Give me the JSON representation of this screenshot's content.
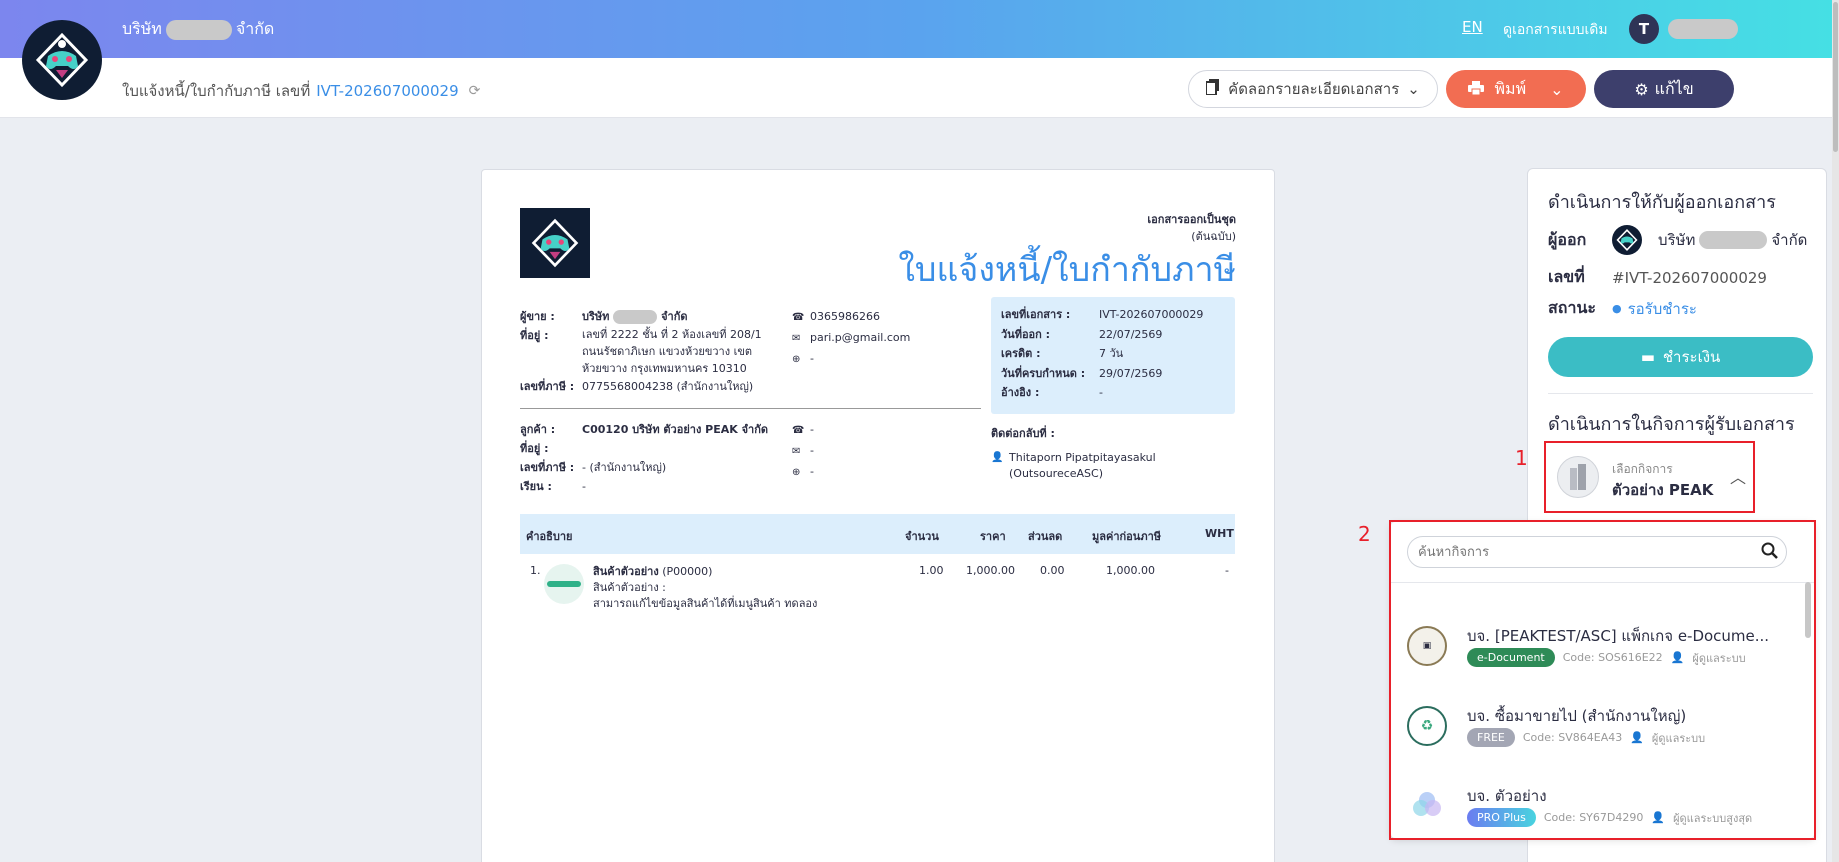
{
  "header": {
    "company_prefix": "บริษัท",
    "company_suffix": "จำกัด",
    "lang": "EN",
    "legacy_docs": "ดูเอกสารแบบเดิม",
    "user_initial": "T"
  },
  "subheader": {
    "doc_type": "ใบแจ้งหนี้/ใบกำกับภาษี เลขที่",
    "doc_number": "IVT-202607000029",
    "copy_label": "คัดลอกรายละเอียดเอกสาร",
    "print_label": "พิมพ์",
    "edit_label": "แก้ไข"
  },
  "document": {
    "series_label": "เอกสารออกเป็นชุด",
    "original_label": "(ต้นฉบับ)",
    "title": "ใบแจ้งหนี้/ใบกำกับภาษี",
    "seller": {
      "seller_label": "ผู้ขาย :",
      "seller_prefix": "บริษัท",
      "seller_suffix": "จำกัด",
      "address_label": "ที่อยู่ :",
      "address": "เลขที่ 2222 ชั้น ที่ 2 ห้องเลขที่ 208/1 ถนนรัชดาภิเษก แขวงห้วยขวาง เขตห้วยขวาง กรุงเทพมหานคร 10310",
      "tax_label": "เลขที่ภาษี :",
      "tax_id": "0775568004238 (สำนักงานใหญ่)",
      "phone": "0365986266",
      "email": "pari.p@gmail.com",
      "web": "-"
    },
    "customer": {
      "customer_label": "ลูกค้า :",
      "customer": "C00120 บริษัท ตัวอย่าง PEAK จำกัด",
      "address_label": "ที่อยู่ :",
      "tax_label": "เลขที่ภาษี :",
      "tax_id": "- (สำนักงานใหญ่)",
      "attn_label": "เรียน :",
      "attn": "-",
      "phone": "-",
      "email": "-",
      "web": "-"
    },
    "info": {
      "doc_no_label": "เลขที่เอกสาร :",
      "doc_no": "IVT-202607000029",
      "issue_label": "วันที่ออก :",
      "issue_date": "22/07/2569",
      "credit_label": "เครดิต :",
      "credit": "7 วัน",
      "due_label": "วันที่ครบกำหนด :",
      "due_date": "29/07/2569",
      "ref_label": "อ้างอิง :",
      "ref": "-"
    },
    "contact_label": "ติดต่อกลับที่ :",
    "contact_name": "Thitaporn Pipatpitayasakul (OutsoureceASC)",
    "table": {
      "headers": [
        "คำอธิบาย",
        "จำนวน",
        "ราคา",
        "ส่วนลด",
        "มูลค่าก่อนภาษี",
        "WHT"
      ],
      "rows": [
        {
          "no": "1.",
          "name": "สินค้าตัวอย่าง",
          "code": "(P00000)",
          "desc1": "สินค้าตัวอย่าง :",
          "desc2": "สามารถแก้ไขข้อมูลสินค้าได้ที่เมนูสินค้า ทดลอง",
          "qty": "1.00",
          "price": "1,000.00",
          "discount": "0.00",
          "amount": "1,000.00",
          "wht": "-"
        }
      ]
    }
  },
  "side": {
    "title": "ดำเนินการให้กับผู้ออกเอกสาร",
    "issuer_label": "ผู้ออก",
    "issuer_prefix": "บริษัท",
    "issuer_suffix": "จำกัด",
    "number_label": "เลขที่",
    "number": "#IVT-202607000029",
    "status_label": "สถานะ",
    "status": "รอรับชำระ",
    "status_color": "#3a8ee6",
    "pay_label": "ชำระเงิน",
    "title2": "ดำเนินการในกิจการผู้รับเอกสาร",
    "select_small": "เลือกกิจการ",
    "select_main": "ตัวอย่าง PEAK"
  },
  "annotations": {
    "n1": "1",
    "n2": "2"
  },
  "dropdown": {
    "search_placeholder": "ค้นหากิจการ",
    "items": [
      {
        "name": "บจ. [PEAKTEST/ASC] แพ็กเกจ e-Docume...",
        "badge": "e-Document",
        "badge_color": "#2e8b57",
        "code": "Code: SOS616E22",
        "role": "ผู้ดูแลระบบ"
      },
      {
        "name": "บจ. ซื้อมาขายไป (สำนักงานใหญ่)",
        "badge": "FREE",
        "badge_color": "#a3a6b4",
        "code": "Code: SV864EA43",
        "role": "ผู้ดูแลระบบ"
      },
      {
        "name": "บจ. ตัวอย่าง",
        "badge": "PRO Plus",
        "badge_color": "#5b8def",
        "code": "Code: SY67D4290",
        "role": "ผู้ดูแลระบบสูงสุด"
      }
    ]
  }
}
